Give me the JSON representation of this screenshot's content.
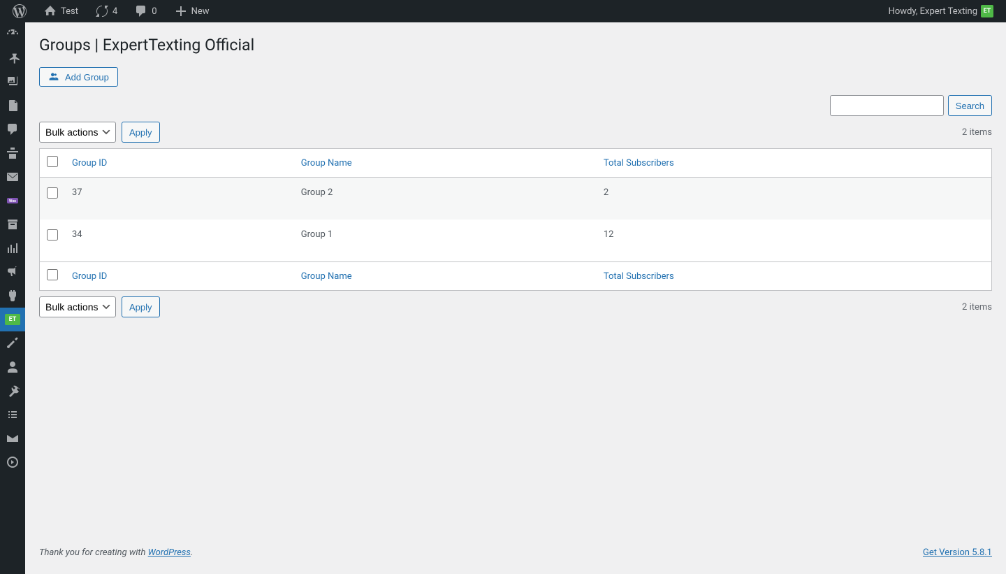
{
  "adminBar": {
    "siteName": "Test",
    "updates": "4",
    "comments": "0",
    "new": "New",
    "howdy": "Howdy, Expert Texting",
    "avatarText": "ET"
  },
  "page": {
    "title": "Groups | ExpertTexting Official",
    "addGroupLabel": "Add Group"
  },
  "search": {
    "buttonLabel": "Search"
  },
  "bulk": {
    "selectLabel": "Bulk actions",
    "applyLabel": "Apply"
  },
  "itemsCount": "2 items",
  "table": {
    "headers": {
      "groupId": "Group ID",
      "groupName": "Group Name",
      "totalSubscribers": "Total Subscribers"
    },
    "rows": [
      {
        "id": "37",
        "name": "Group 2",
        "subscribers": "2"
      },
      {
        "id": "34",
        "name": "Group 1",
        "subscribers": "12"
      }
    ]
  },
  "footer": {
    "thankYou": "Thank you for creating with ",
    "wordpress": "WordPress",
    "dot": ".",
    "version": "Get Version 5.8.1"
  },
  "sidebar": {
    "etBadge": "ET"
  }
}
